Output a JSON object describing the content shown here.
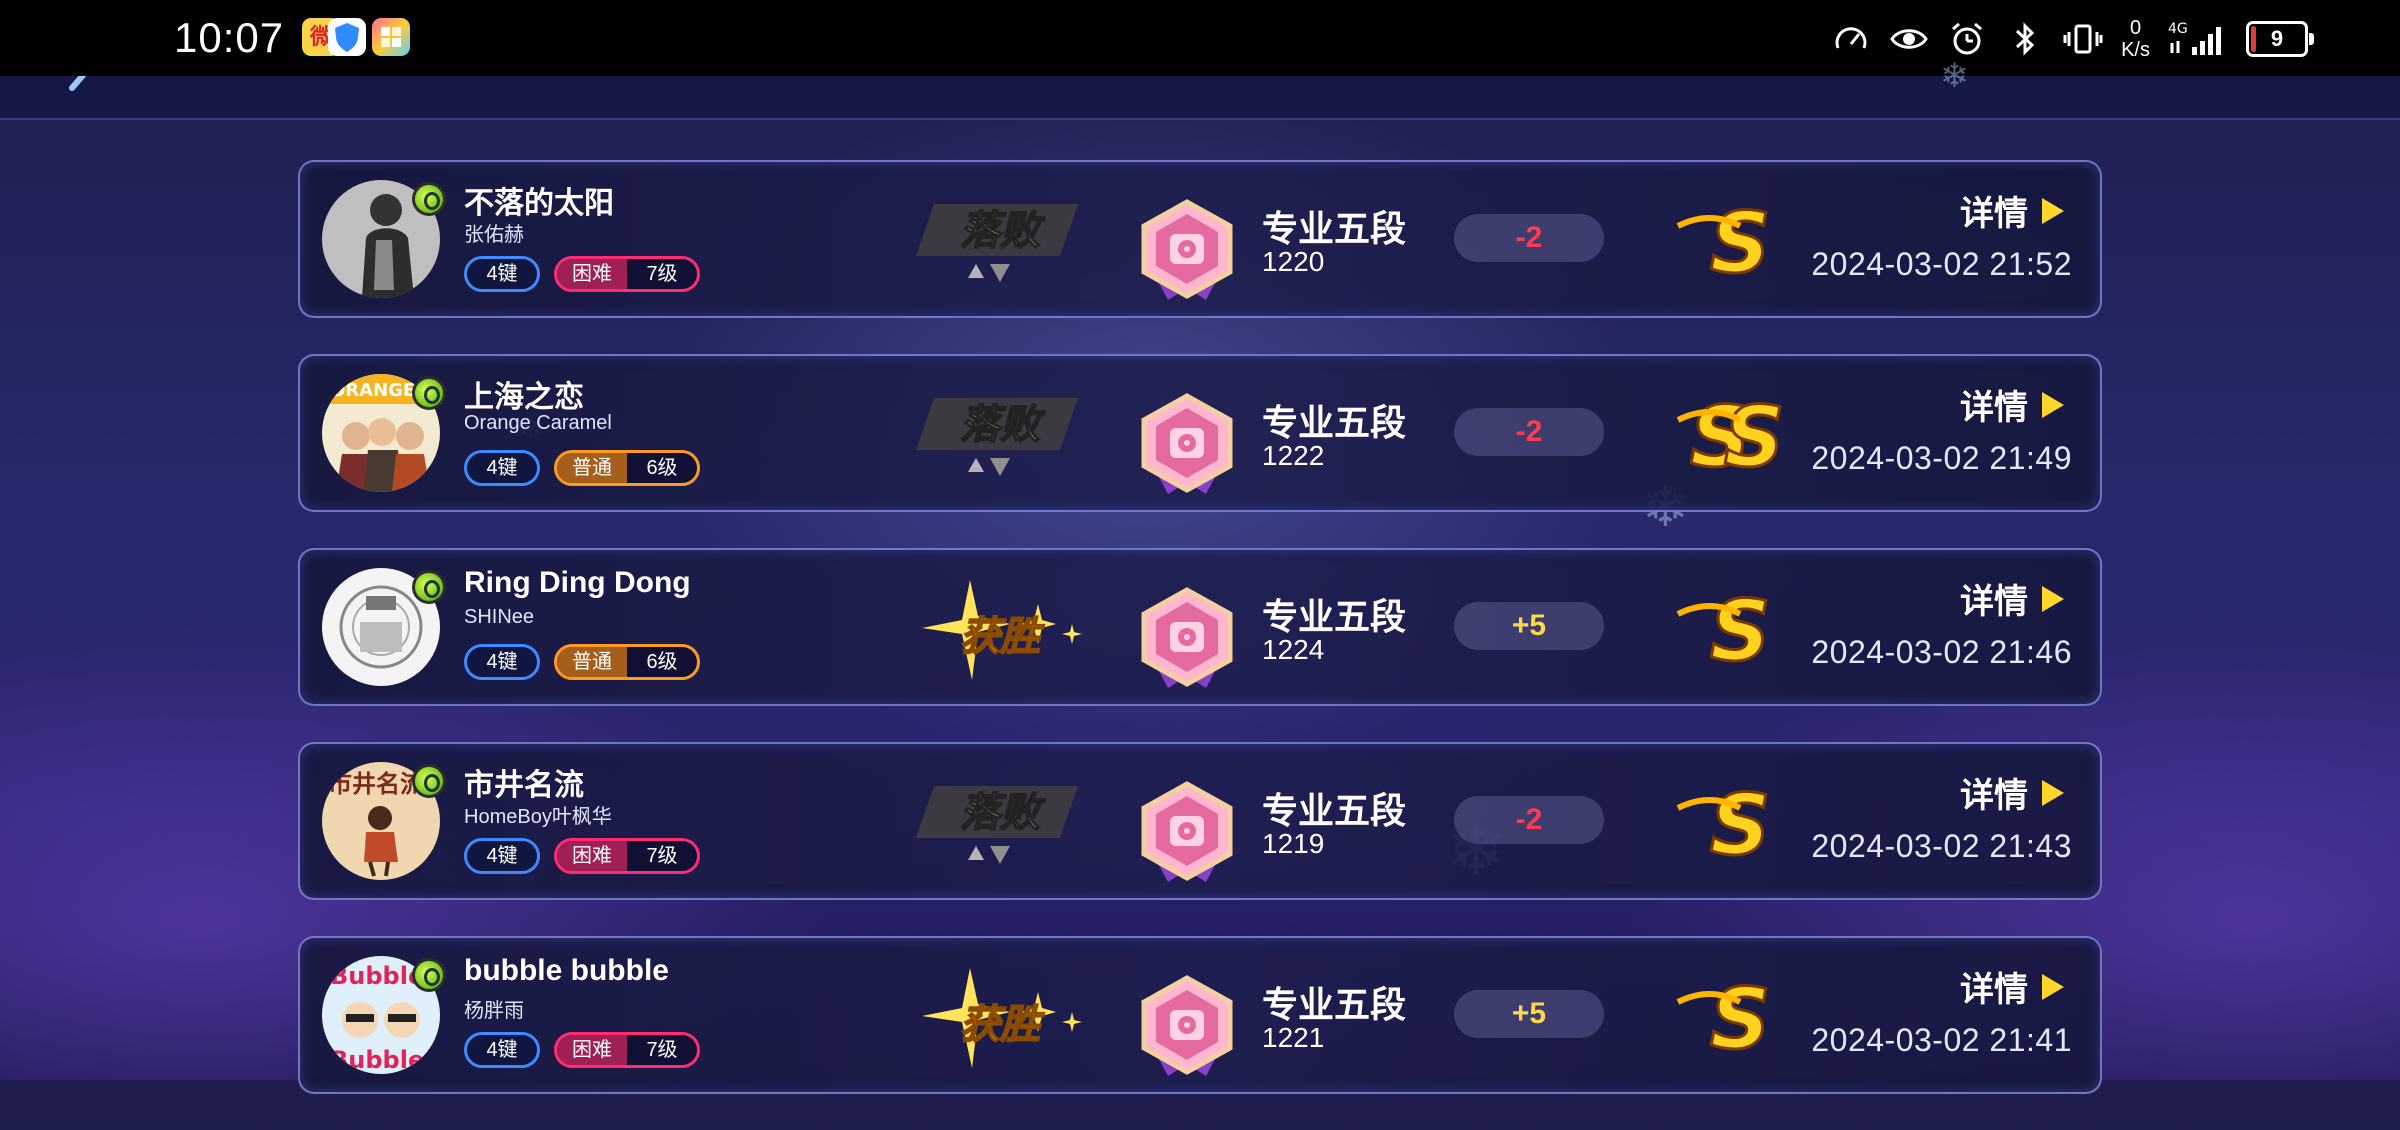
{
  "status_bar": {
    "time": "10:07",
    "speed_value": "0",
    "speed_unit": "K/s",
    "network": "4G",
    "battery": "9",
    "apps": [
      "weibo-app-icon",
      "shield-app-icon",
      "tiles-app-icon"
    ]
  },
  "rows": [
    {
      "title": "不落的太阳",
      "artist": "张佑赫",
      "keys": "4键",
      "diff_name": "困难",
      "diff_level": "7级",
      "diff_type": "hard",
      "result": "落败",
      "rank": "专业五段",
      "score": "1220",
      "delta": "-2",
      "delta_type": "neg",
      "grade": "S",
      "detail": "详情",
      "date": "2024-03-02 21:52",
      "cover": "cover-1"
    },
    {
      "title": "上海之恋",
      "artist": "Orange Caramel",
      "keys": "4键",
      "diff_name": "普通",
      "diff_level": "6级",
      "diff_type": "normal",
      "result": "落败",
      "rank": "专业五段",
      "score": "1222",
      "delta": "-2",
      "delta_type": "neg",
      "grade": "SS",
      "detail": "详情",
      "date": "2024-03-02 21:49",
      "cover": "cover-2"
    },
    {
      "title": "Ring Ding Dong",
      "artist": "SHINee",
      "keys": "4键",
      "diff_name": "普通",
      "diff_level": "6级",
      "diff_type": "normal",
      "result": "获胜",
      "rank": "专业五段",
      "score": "1224",
      "delta": "+5",
      "delta_type": "pos",
      "grade": "S",
      "detail": "详情",
      "date": "2024-03-02 21:46",
      "cover": "cover-3"
    },
    {
      "title": "市井名流",
      "artist": "HomeBoy叶枫华",
      "keys": "4键",
      "diff_name": "困难",
      "diff_level": "7级",
      "diff_type": "hard",
      "result": "落败",
      "rank": "专业五段",
      "score": "1219",
      "delta": "-2",
      "delta_type": "neg",
      "grade": "S",
      "detail": "详情",
      "date": "2024-03-02 21:43",
      "cover": "cover-4"
    },
    {
      "title": "bubble bubble",
      "artist": "杨胖雨",
      "keys": "4键",
      "diff_name": "困难",
      "diff_level": "7级",
      "diff_type": "hard",
      "result": "获胜",
      "rank": "专业五段",
      "score": "1221",
      "delta": "+5",
      "delta_type": "pos",
      "grade": "S",
      "detail": "详情",
      "date": "2024-03-02 21:41",
      "cover": "cover-5"
    }
  ]
}
